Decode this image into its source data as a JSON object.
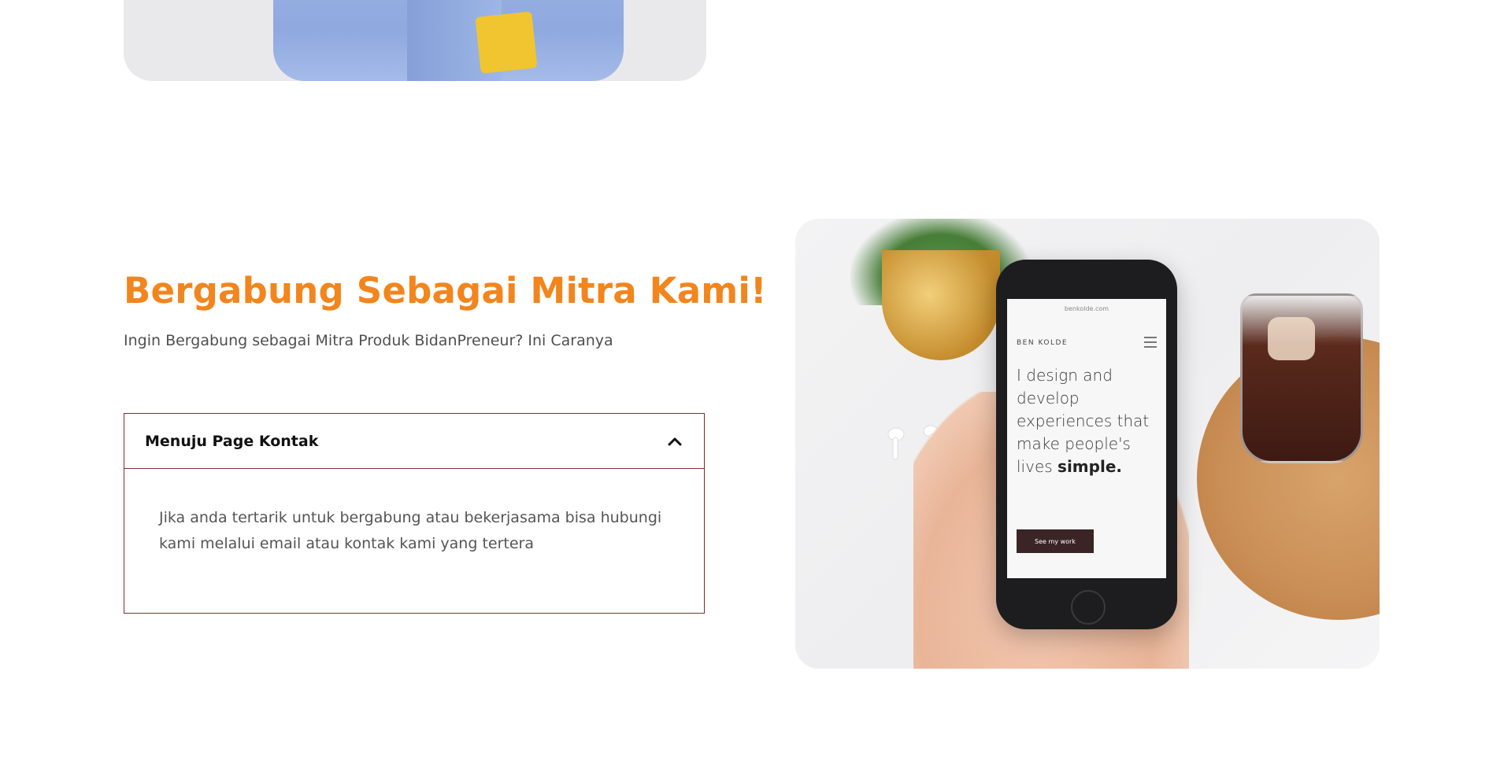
{
  "section": {
    "title": "Bergabung Sebagai Mitra Kami!",
    "subtitle": "Ingin Bergabung sebagai Mitra Produk BidanPreneur? Ini Caranya"
  },
  "accordion": {
    "title": "Menuju Page Kontak",
    "expanded": true,
    "body": "Jika anda tertarik untuk bergabung atau bekerjasama bisa hubungi kami melalui email atau kontak kami yang tertera"
  },
  "photo": {
    "phone_url": "benkolde.com",
    "phone_brand": "BEN KOLDE",
    "phone_headline_plain": "I design and develop experiences that make people's lives",
    "phone_headline_bold": "simple.",
    "phone_button": "See my work"
  },
  "colors": {
    "title": "#f2851d",
    "accordion_border": "#8a2a33",
    "body_text": "#555555"
  },
  "icons": {
    "accordion_toggle": "chevron-up-icon"
  }
}
